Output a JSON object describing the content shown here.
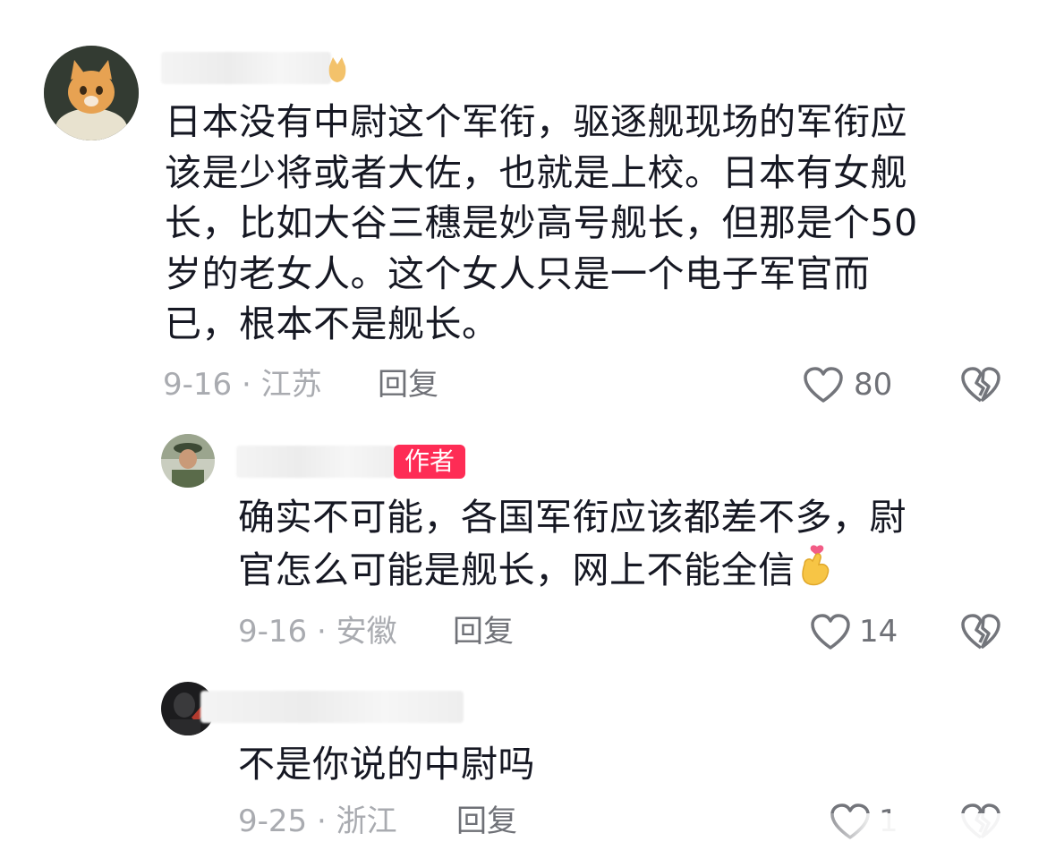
{
  "comments": [
    {
      "text": "日本没有中尉这个军衔，驱逐舰现场的军衔应该是少将或者大佐，也就是上校。日本有女舰长，比如大谷三穗是妙高号舰长，但那是个50岁的老女人。这个女人只是一个电子军官而已，根本不是舰长。",
      "lines": [
        "日本没有中尉这个军衔，驱逐舰现场的军衔应",
        "该是少将或者大佐，也就是上校。日本有女舰",
        "长，比如大谷三穗是妙高号舰长，但那是个50",
        "岁的老女人。这个女人只是一个电子军官而",
        "已，根本不是舰长。"
      ],
      "date_location": "9-16 · 江苏",
      "reply_label": "回复",
      "likes": "80"
    },
    {
      "author_tag": "作者",
      "lines": [
        "确实不可能，各国军衔应该都差不多，尉",
        "官怎么可能是舰长，网上不能全信"
      ],
      "date_location": "9-16 · 安徽",
      "reply_label": "回复",
      "likes": "14"
    },
    {
      "lines": [
        "不是你说的中尉吗"
      ],
      "date_location": "9-25 · 浙江",
      "reply_label": "回复",
      "likes": "1"
    }
  ],
  "icons": {
    "like": "heart-outline-icon",
    "dislike": "broken-heart-icon",
    "emoji": "hand-with-heart-emoji"
  },
  "colors": {
    "author_tag": "#fe2c55",
    "meta": "#a9abb0",
    "text": "#161823"
  }
}
